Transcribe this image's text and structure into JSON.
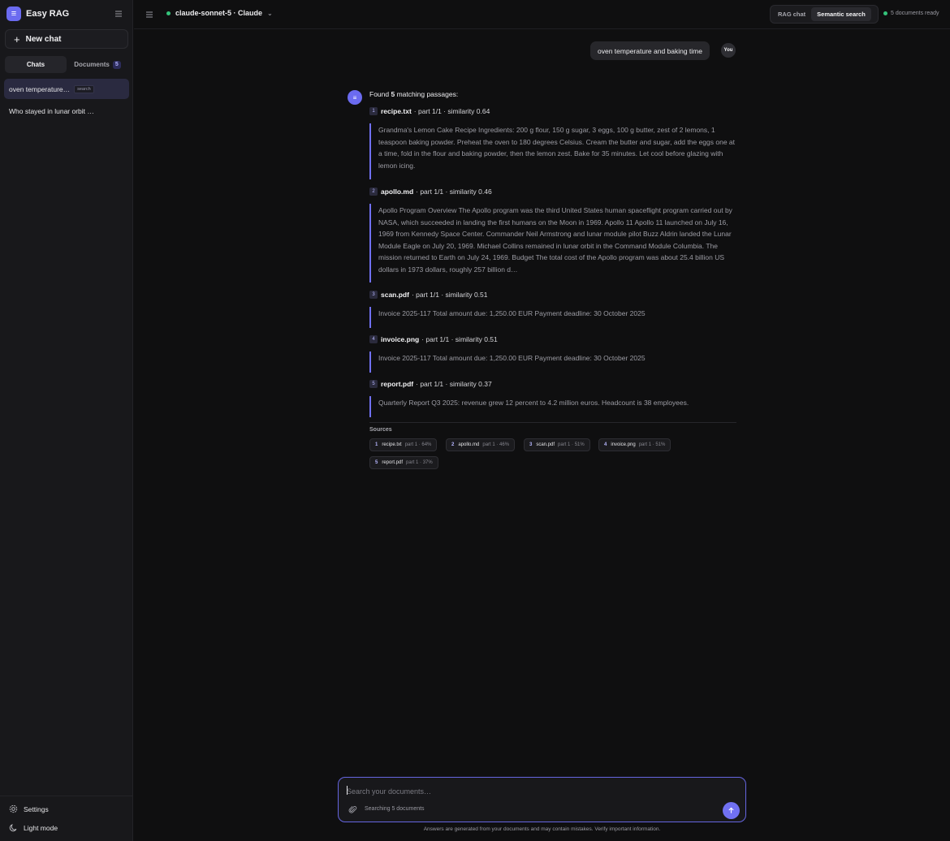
{
  "app": {
    "name": "Easy RAG",
    "logo_glyph": "≡"
  },
  "sidebar": {
    "new_chat_label": "New chat",
    "tabs": [
      {
        "label": "Chats",
        "active": true
      },
      {
        "label": "Documents",
        "count": "5"
      }
    ],
    "chats": [
      {
        "title": "oven temperature…",
        "tag": "search",
        "active": true
      },
      {
        "title": "Who stayed in lunar orbit …"
      }
    ],
    "settings_label": "Settings",
    "theme_label": "Light mode"
  },
  "topbar": {
    "model_label": "claude-sonnet-5 · Claude",
    "modes": [
      {
        "label": "RAG chat"
      },
      {
        "label": "Semantic search",
        "active": true
      }
    ],
    "status": "5 documents ready"
  },
  "conversation": {
    "user_message": "oven temperature and baking time",
    "user_avatar": "You",
    "assistant_avatar_glyph": "≡",
    "found_prefix": "Found",
    "found_count": "5",
    "found_suffix": "matching passages:",
    "results": [
      {
        "num": "1",
        "file": "recipe.txt",
        "meta": "· part 1/1 · similarity 0.64",
        "text": "Grandma's Lemon Cake Recipe Ingredients: 200 g flour, 150 g sugar, 3 eggs, 100 g butter, zest of 2 lemons, 1 teaspoon baking powder. Preheat the oven to 180 degrees Celsius. Cream the butter and sugar, add the eggs one at a time, fold in the flour and baking powder, then the lemon zest. Bake for 35 minutes. Let cool before glazing with lemon icing."
      },
      {
        "num": "2",
        "file": "apollo.md",
        "meta": "· part 1/1 · similarity 0.46",
        "text": "Apollo Program Overview The Apollo program was the third United States human spaceflight program carried out by NASA, which succeeded in landing the first humans on the Moon in 1969. Apollo 11 Apollo 11 launched on July 16, 1969 from Kennedy Space Center. Commander Neil Armstrong and lunar module pilot Buzz Aldrin landed the Lunar Module Eagle on July 20, 1969. Michael Collins remained in lunar orbit in the Command Module Columbia. The mission returned to Earth on July 24, 1969. Budget The total cost of the Apollo program was about 25.4 billion US dollars in 1973 dollars, roughly 257 billion d…"
      },
      {
        "num": "3",
        "file": "scan.pdf",
        "meta": "· part 1/1 · similarity 0.51",
        "text": "Invoice 2025-117 Total amount due: 1,250.00 EUR Payment deadline: 30 October 2025"
      },
      {
        "num": "4",
        "file": "invoice.png",
        "meta": "· part 1/1 · similarity 0.51",
        "text": "Invoice 2025-117 Total amount due: 1,250.00 EUR Payment deadline: 30 October 2025"
      },
      {
        "num": "5",
        "file": "report.pdf",
        "meta": "· part 1/1 · similarity 0.37",
        "text": "Quarterly Report Q3 2025: revenue grew 12 percent to 4.2 million euros. Headcount is 38 employees."
      }
    ],
    "sources_label": "Sources",
    "sources": [
      {
        "num": "1",
        "file": "recipe.txt",
        "meta": "part 1 · 64%"
      },
      {
        "num": "2",
        "file": "apollo.md",
        "meta": "part 1 · 46%"
      },
      {
        "num": "3",
        "file": "scan.pdf",
        "meta": "part 1 · 51%"
      },
      {
        "num": "4",
        "file": "invoice.png",
        "meta": "part 1 · 51%"
      },
      {
        "num": "5",
        "file": "report.pdf",
        "meta": "part 1 · 37%"
      }
    ]
  },
  "composer": {
    "placeholder": "Search your documents…",
    "value": "",
    "searching_label": "Searching 5 documents",
    "disclaimer": "Answers are generated from your documents and may contain mistakes. Verify important information."
  },
  "colors": {
    "accent": "#7070f2",
    "status_ok": "#34c37a",
    "background": "#0f0f10",
    "sidebar": "#18181b"
  }
}
